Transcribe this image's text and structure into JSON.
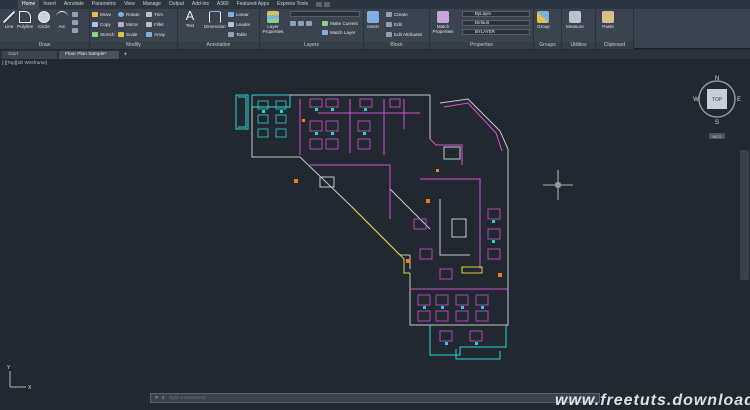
{
  "ribbon_tabs": [
    "Home",
    "Insert",
    "Annotate",
    "Parametric",
    "View",
    "Manage",
    "Output",
    "Add-ins",
    "A360",
    "Featured Apps",
    "Express Tools"
  ],
  "panels": {
    "draw": {
      "title": "Draw",
      "line": "Line",
      "polyline": "Polyline",
      "circle": "Circle",
      "arc": "Arc"
    },
    "modify": {
      "title": "Modify",
      "move": "Move",
      "rotate": "Rotate",
      "trim": "Trim",
      "copy": "Copy",
      "mirror": "Mirror",
      "fillet": "Fillet",
      "stretch": "Stretch",
      "scale": "Scale",
      "array": "Array"
    },
    "annotation": {
      "title": "Annotation",
      "text": "Text",
      "dimension": "Dimension",
      "linear": "Linear",
      "leader": "Leader",
      "table": "Table"
    },
    "layers": {
      "title": "Layers",
      "layer_properties": "Layer Properties",
      "make_current": "Make Current",
      "match_layer": "Match Layer"
    },
    "block": {
      "title": "Block",
      "insert": "Insert",
      "create": "Create",
      "edit": "Edit",
      "edit_attributes": "Edit Attributes"
    },
    "properties": {
      "title": "Properties",
      "match_properties": "Match Properties",
      "color": "ByLayer",
      "linetype": "Default",
      "lineweight": "BYLAYER"
    },
    "groups": {
      "title": "Groups",
      "group": "Group"
    },
    "utilities": {
      "title": "Utilities",
      "measure": "Measure"
    },
    "clipboard": {
      "title": "Clipboard",
      "paste": "Paste"
    }
  },
  "doc_tabs": [
    {
      "label": "Start"
    },
    {
      "label": "Floor Plan Sample*"
    }
  ],
  "viewport_label": "[-][Top][2D Wireframe]",
  "viewcube": {
    "top": "TOP",
    "n": "N",
    "s": "S",
    "e": "E",
    "w": "W",
    "ucs": "WCS"
  },
  "command": {
    "placeholder": "Type a command",
    "close": "×"
  },
  "watermark": "www.freetuts.download",
  "colors": {
    "canvas": "#212830",
    "ribbon": "#3b434e"
  }
}
